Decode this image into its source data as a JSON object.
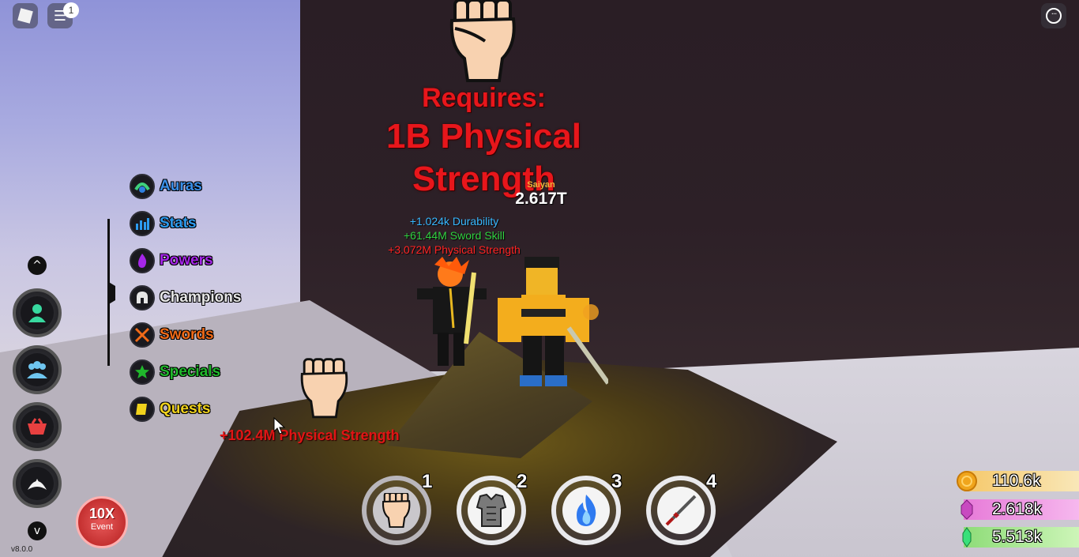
{
  "banner": {
    "requires": "Requires:",
    "requirement": "1B Physical Strength"
  },
  "player": {
    "rank": "Saiyan",
    "power": "2.617T",
    "gains": [
      "+1.024k Durability",
      "+61.44M Sword Skill",
      "+3.072M Physical Strength"
    ]
  },
  "popup": {
    "gain_text": "+102.4M Physical Strength"
  },
  "topbar": {
    "notification_count": "1"
  },
  "menu": {
    "items": [
      {
        "label": "Auras",
        "color": "#3a8ee8",
        "icon": "aura-icon"
      },
      {
        "label": "Stats",
        "color": "#2d9cf0",
        "icon": "stats-icon"
      },
      {
        "label": "Powers",
        "color": "#a526e8",
        "icon": "flame-icon"
      },
      {
        "label": "Champions",
        "color": "#e6e6e6",
        "icon": "helmet-icon"
      },
      {
        "label": "Swords",
        "color": "#f06a18",
        "icon": "crossed-swords-icon"
      },
      {
        "label": "Specials",
        "color": "#20b82c",
        "icon": "star-icon"
      },
      {
        "label": "Quests",
        "color": "#f0d21c",
        "icon": "scroll-icon"
      }
    ]
  },
  "side_buttons": {
    "up_arrow": "^",
    "down_arrow": "v",
    "items": [
      "profile-icon",
      "friends-icon",
      "shop-basket-icon",
      "crown-icon"
    ]
  },
  "event": {
    "multiplier": "10X",
    "label": "Event"
  },
  "version": "v8.0.0",
  "hotbar": {
    "slots": [
      {
        "key": "1",
        "icon": "fist-icon"
      },
      {
        "key": "2",
        "icon": "armor-icon"
      },
      {
        "key": "3",
        "icon": "blue-flame-icon"
      },
      {
        "key": "4",
        "icon": "sword-icon"
      }
    ]
  },
  "currencies": [
    {
      "value": "110.6k",
      "icon": "coin-icon",
      "color": "#f7d99a"
    },
    {
      "value": "2.618k",
      "icon": "purple-gem-icon",
      "color": "#f2a6e6"
    },
    {
      "value": "5.513k",
      "icon": "green-gem-icon",
      "color": "#b6ef9f"
    }
  ]
}
